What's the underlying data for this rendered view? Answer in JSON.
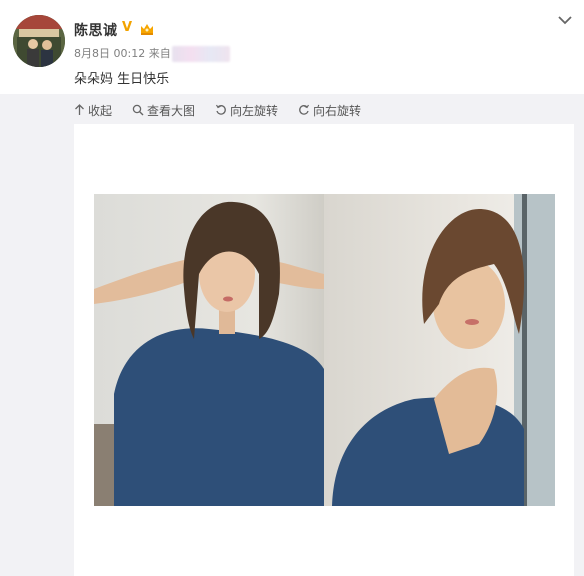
{
  "post": {
    "username": "陈思诚",
    "vip_mark": "V",
    "date": "8月8日",
    "time": "00:12",
    "source_prefix": "来自",
    "text": "朵朵妈 生日快乐"
  },
  "toolbar": {
    "collapse_label": "收起",
    "view_large_label": "查看大图",
    "rotate_left_label": "向左旋转",
    "rotate_right_label": "向右旋转"
  },
  "icons": {
    "avatar": "avatar-photo",
    "vip": "vip-v-icon",
    "member": "crown-icon",
    "menu": "chevron-down-icon",
    "collapse": "arrow-up-icon",
    "zoom": "magnifier-icon",
    "rotate_left": "rotate-left-icon",
    "rotate_right": "rotate-right-icon"
  },
  "colors": {
    "vip": "#f2a300",
    "media_background": "#f2f2f5",
    "shirt": "#2e4f78"
  }
}
